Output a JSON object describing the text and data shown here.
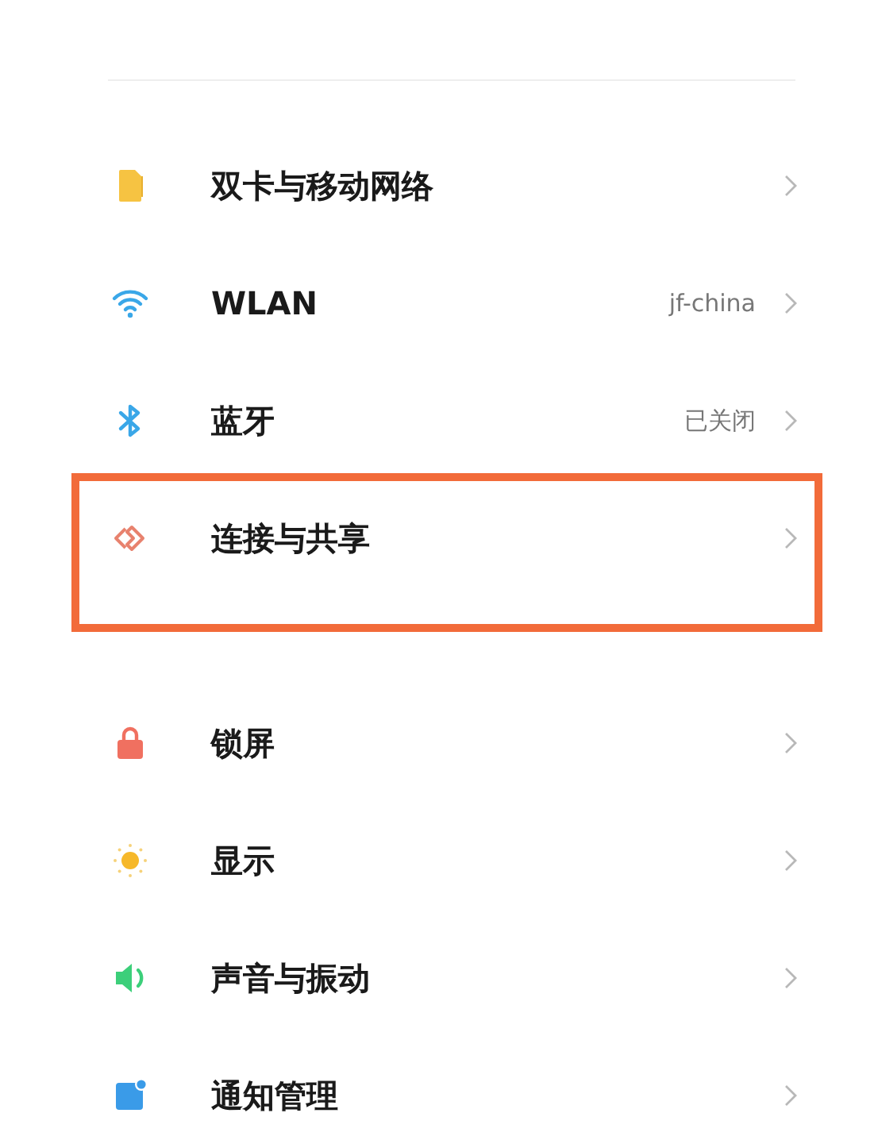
{
  "groups": [
    {
      "items": [
        {
          "kind": "sim",
          "label": "双卡与移动网络",
          "highlighted": false
        },
        {
          "kind": "wifi",
          "label": "WLAN",
          "value": "jf-china",
          "highlighted": false
        },
        {
          "kind": "bluetooth",
          "label": "蓝牙",
          "value": "已关闭",
          "highlighted": false
        },
        {
          "kind": "share",
          "label": "连接与共享",
          "highlighted": true
        }
      ]
    },
    {
      "items": [
        {
          "kind": "lock",
          "label": "锁屏",
          "highlighted": false
        },
        {
          "kind": "display",
          "label": "显示",
          "highlighted": false
        },
        {
          "kind": "sound",
          "label": "声音与振动",
          "highlighted": false
        },
        {
          "kind": "notify",
          "label": "通知管理",
          "highlighted": false
        }
      ]
    }
  ]
}
